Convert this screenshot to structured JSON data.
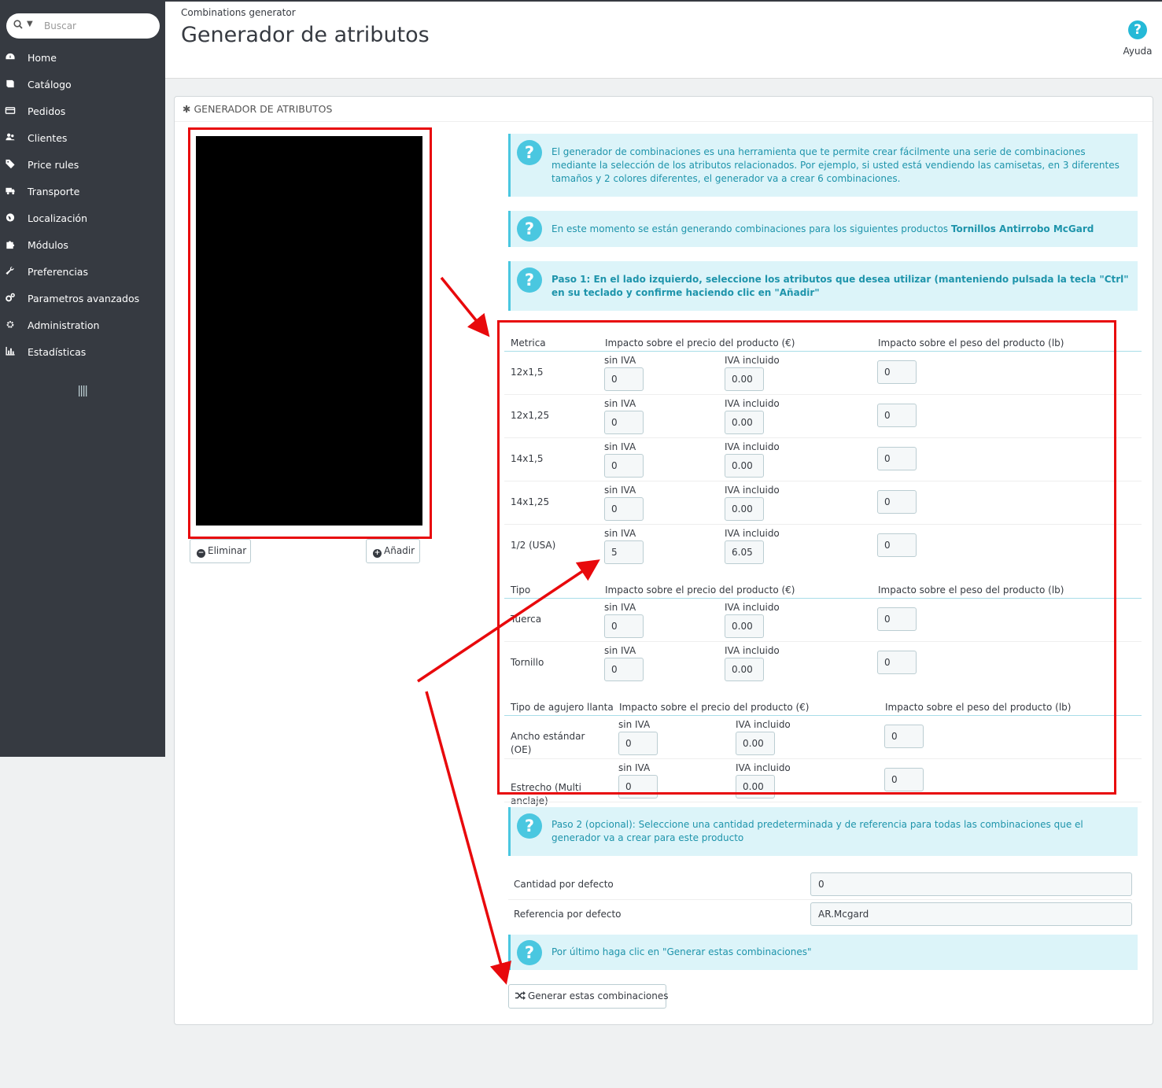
{
  "search": {
    "placeholder": "Buscar"
  },
  "sidebar": {
    "items": [
      {
        "label": "Home",
        "icon": "dashboard-icon"
      },
      {
        "label": "Catálogo",
        "icon": "book-icon"
      },
      {
        "label": "Pedidos",
        "icon": "credit-card-icon"
      },
      {
        "label": "Clientes",
        "icon": "users-icon"
      },
      {
        "label": "Price rules",
        "icon": "tags-icon"
      },
      {
        "label": "Transporte",
        "icon": "truck-icon"
      },
      {
        "label": "Localización",
        "icon": "globe-icon"
      },
      {
        "label": "Módulos",
        "icon": "puzzle-icon"
      },
      {
        "label": "Preferencias",
        "icon": "wrench-icon"
      },
      {
        "label": "Parametros avanzados",
        "icon": "cogs-icon"
      },
      {
        "label": "Administration",
        "icon": "gear-icon"
      },
      {
        "label": "Estadísticas",
        "icon": "bar-chart-icon"
      }
    ]
  },
  "header": {
    "breadcrumb": "Combinations generator",
    "title": "Generador de atributos",
    "help_label": "Ayuda"
  },
  "panel": {
    "heading": "Generador de atributos",
    "remove_label": "Eliminar",
    "add_label": "Añadir"
  },
  "alerts": {
    "intro": "El generador de combinaciones es una herramienta que te permite crear fácilmente una serie de combinaciones mediante la selección de los atributos relacionados. Por ejemplo, si usted está vendiendo las camisetas, en 3 diferentes tamaños y 2 colores diferentes, el generador va a crear 6 combinaciones.",
    "current_prefix": "En este momento se están generando combinaciones para los siguientes productos ",
    "current_product": "Tornillos Antirrobo McGard",
    "step1": "Paso 1: En el lado izquierdo, seleccione los atributos que desea utilizar (manteniendo pulsada la tecla \"Ctrl\" en su teclado y confirme haciendo clic en \"Añadir\"",
    "step2": "Paso 2 (opcional): Seleccione una cantidad predeterminada y de referencia para todas las combinaciones que el generador va a crear para este producto",
    "final": "Por último haga clic en \"Generar estas combinaciones\""
  },
  "labels": {
    "price_impact": "Impacto sobre el precio del producto (€)",
    "weight_impact": "Impacto sobre el peso del producto (lb)",
    "tax_excl": "sin IVA",
    "tax_incl": "IVA incluido"
  },
  "groups": [
    {
      "name": "Metrica",
      "rows": [
        {
          "label": "12x1,5",
          "excl": "0",
          "incl": "0.00",
          "weight": "0"
        },
        {
          "label": "12x1,25",
          "excl": "0",
          "incl": "0.00",
          "weight": "0"
        },
        {
          "label": "14x1,5",
          "excl": "0",
          "incl": "0.00",
          "weight": "0"
        },
        {
          "label": "14x1,25",
          "excl": "0",
          "incl": "0.00",
          "weight": "0"
        },
        {
          "label": "1/2 (USA)",
          "excl": "5",
          "incl": "6.05",
          "weight": "0"
        }
      ]
    },
    {
      "name": "Tipo",
      "rows": [
        {
          "label": "Tuerca",
          "excl": "0",
          "incl": "0.00",
          "weight": "0"
        },
        {
          "label": "Tornillo",
          "excl": "0",
          "incl": "0.00",
          "weight": "0"
        }
      ]
    },
    {
      "name": "Tipo de agujero llanta",
      "rows": [
        {
          "label": "Ancho estándar (OE)",
          "excl": "0",
          "incl": "0.00",
          "weight": "0"
        },
        {
          "label": "Estrecho (Multi anclaje)",
          "excl": "0",
          "incl": "0.00",
          "weight": "0"
        }
      ]
    }
  ],
  "defaults": {
    "quantity_label": "Cantidad por defecto",
    "quantity_value": "0",
    "reference_label": "Referencia por defecto",
    "reference_value": "AR.Mcgard"
  },
  "generate_label": "Generar estas combinaciones",
  "colors": {
    "sidebar": "#363a41",
    "accent": "#25b9d7",
    "alert_bg": "#dcf4f9",
    "alert_text": "#1e94ab",
    "annotation_red": "#e8090c"
  }
}
